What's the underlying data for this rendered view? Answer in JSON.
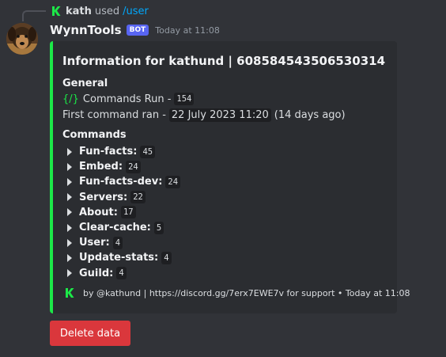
{
  "interaction": {
    "user": "kath",
    "used_text": "used",
    "command": "/user"
  },
  "message": {
    "author": "WynnTools",
    "bot_tag": "BOT",
    "timestamp": "Today at 11:08"
  },
  "embed": {
    "accent_color": "#1ce848",
    "title": "Information for kathund | 608584543506530314",
    "general": {
      "heading": "General",
      "commands_run_label": "Commands Run -",
      "commands_run_value": "154",
      "first_ran_label": "First command ran -",
      "first_ran_value": "22 July 2023 11:20",
      "first_ran_relative": "(14 days ago)"
    },
    "commands": {
      "heading": "Commands",
      "items": [
        {
          "name": "Fun-facts:",
          "count": "45"
        },
        {
          "name": "Embed:",
          "count": "24"
        },
        {
          "name": "Fun-facts-dev:",
          "count": "24"
        },
        {
          "name": "Servers:",
          "count": "22"
        },
        {
          "name": "About:",
          "count": "17"
        },
        {
          "name": "Clear-cache:",
          "count": "5"
        },
        {
          "name": "User:",
          "count": "4"
        },
        {
          "name": "Update-stats:",
          "count": "4"
        },
        {
          "name": "Guild:",
          "count": "4"
        }
      ]
    },
    "footer": "by @kathund | https://discord.gg/7erx7EWE7v for support • Today at 11:08"
  },
  "button": {
    "label": "Delete data",
    "color": "#da373c"
  },
  "icons": {
    "app_logo": "wynntools-k-icon",
    "slash": "slash-command-icon",
    "expand": "triangle-right-icon"
  }
}
